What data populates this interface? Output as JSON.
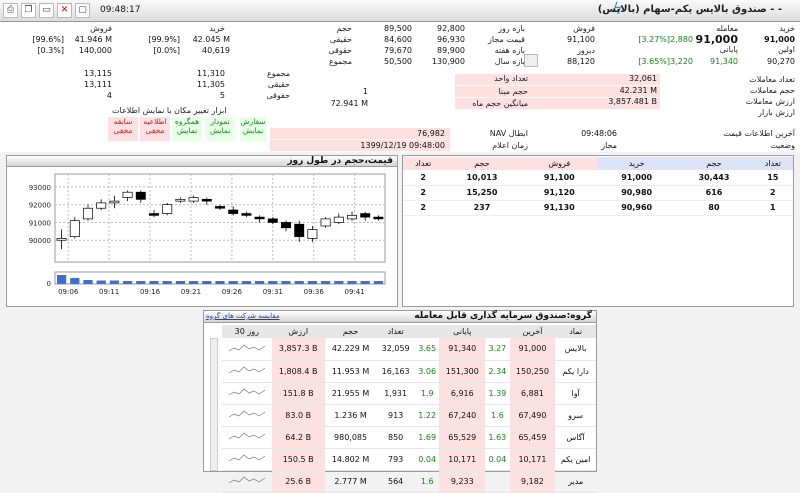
{
  "app": {
    "clock": "09:48:17",
    "title": "صندوق بالایس یکم-سهام (بالایس) - -"
  },
  "toolbar": {
    "icons": [
      "print",
      "copy",
      "save",
      "tools",
      "window",
      "close"
    ]
  },
  "info": {
    "col1": [
      {
        "label": "خرید",
        "value": "معامله"
      },
      {
        "label": "",
        "value": ""
      },
      {
        "label": "91,000",
        "value": "اولین"
      },
      {
        "label": "90,270",
        "value": "پایانی"
      }
    ],
    "trade": {
      "label": "معامله",
      "value": "91,000",
      "change": "2,880",
      "pct": "[3.27%]"
    },
    "first": {
      "label": "اولین",
      "value": "91,000"
    },
    "last": {
      "label": "پایانی",
      "value": "91,340",
      "change": "3,220",
      "pct": "[3.65%]",
      "buy": "90,270"
    },
    "yesterday": {
      "label": "دیروز",
      "value": "88,120"
    },
    "sale": {
      "label": "فروش",
      "value": ""
    },
    "range_day": {
      "label": "بازه روز",
      "low": "92,800",
      "high": "89,500"
    },
    "range_allowed": {
      "label": "قیمت مجاز",
      "low": "96,930",
      "high": "84,600"
    },
    "range_week": {
      "label": "بازه هفته",
      "low": "89,900",
      "high": "79,670"
    },
    "range_year": {
      "label": "بازه سال",
      "low": "130,900",
      "high": "50,500"
    },
    "allowed_val": "91,100",
    "count_headers": {
      "vol": "حجم",
      "buy": "خرید",
      "sell": "فروش"
    },
    "legal": {
      "label": "حقیقی",
      "vol": "42.045 M",
      "vol_pct": "[99.9%]",
      "sell_vol": "41.946 M",
      "sell_pct": "[99.6%]"
    },
    "legal2": {
      "label": "حقوقی",
      "vol": "40,619",
      "vol_pct": "[0.0%]",
      "sell_vol": "140,000",
      "sell_pct": "[0.3%]"
    },
    "counts_header": {
      "buy": "خرید",
      "sell": "فروش"
    },
    "total": {
      "label": "مجموع",
      "buy": "11,310",
      "sell": "13,115"
    },
    "real": {
      "label": "حقیقی",
      "buy": "11,305",
      "sell": "13,111"
    },
    "legalc": {
      "label": "حقوقی",
      "buy": "5",
      "sell": "4"
    },
    "unit": {
      "label": "تعداد واحد",
      "value": "32,061"
    },
    "basevol": {
      "label": "حجم مبنا",
      "value": "1"
    },
    "avgvol": {
      "label": "میانگین حجم ماه",
      "value": "72.941 M"
    },
    "trades": {
      "label": "تعداد معاملات",
      "value": "32,061"
    },
    "volume": {
      "label": "حجم معاملات",
      "value": "42.231 M"
    },
    "tvalue": {
      "label": "ارزش معاملات",
      "value": "3,857.481 B"
    },
    "mcap": {
      "label": "ارزش بازار",
      "value": ""
    },
    "nav_cancel": {
      "label": "NAV ابطال",
      "value": "76,982"
    },
    "nav_time": {
      "label": "زمان اعلام",
      "value": "1399/12/19 09:48:00"
    },
    "last_info": {
      "label": "آخرین اطلاعات قیمت",
      "value": "09:48:06"
    },
    "status": {
      "label": "وضعیت",
      "value": "مجاز"
    },
    "tools_note": "ابزار تغییر مکان یا نمایش اطلاعات",
    "buttons": [
      {
        "l1": "سفارش",
        "l2": "نمایش"
      },
      {
        "l1": "نمودار",
        "l2": "نمایش"
      },
      {
        "l1": "همگروه",
        "l2": "نمایش"
      },
      {
        "l1": "اطلاعیه",
        "l2": "مخفی"
      },
      {
        "l1": "سابقه",
        "l2": "مخفی"
      }
    ]
  },
  "orderbook": {
    "headers": [
      "تعداد",
      "حجم",
      "خرید",
      "فروش",
      "حجم",
      "تعداد"
    ],
    "rows": [
      [
        "15",
        "30,443",
        "91,000",
        "91,100",
        "10,013",
        "2"
      ],
      [
        "2",
        "616",
        "90,980",
        "91,120",
        "15,250",
        "2"
      ],
      [
        "1",
        "80",
        "90,960",
        "91,130",
        "237",
        "2"
      ]
    ]
  },
  "chart_panel": {
    "title": "قیمت،حجم در طول روز"
  },
  "chart_data": {
    "type": "candlestick",
    "title": "قیمت،حجم در طول روز",
    "x_ticks": [
      "09:06",
      "09:11",
      "09:16",
      "09:21",
      "09:26",
      "09:31",
      "09:36",
      "09:41"
    ],
    "y_ticks": [
      "93000",
      "92000",
      "91000",
      "90000"
    ],
    "y_vol_ticks": [
      "0"
    ],
    "ylim": [
      89000,
      93500
    ],
    "candles": [
      {
        "o": 90000,
        "c": 90100,
        "h": 90600,
        "l": 89500
      },
      {
        "o": 90200,
        "c": 91100,
        "h": 91300,
        "l": 90100
      },
      {
        "o": 91200,
        "c": 91800,
        "h": 92000,
        "l": 91100
      },
      {
        "o": 91800,
        "c": 92100,
        "h": 92300,
        "l": 91700
      },
      {
        "o": 92100,
        "c": 92200,
        "h": 92500,
        "l": 91800
      },
      {
        "o": 92400,
        "c": 92700,
        "h": 92800,
        "l": 92200
      },
      {
        "o": 92700,
        "c": 92300,
        "h": 92800,
        "l": 92100
      },
      {
        "o": 91500,
        "c": 91400,
        "h": 91700,
        "l": 91300
      },
      {
        "o": 91500,
        "c": 92000,
        "h": 92100,
        "l": 91400
      },
      {
        "o": 92200,
        "c": 92300,
        "h": 92400,
        "l": 92100
      },
      {
        "o": 92200,
        "c": 92400,
        "h": 92500,
        "l": 92100
      },
      {
        "o": 92300,
        "c": 92200,
        "h": 92400,
        "l": 92000
      },
      {
        "o": 91900,
        "c": 91800,
        "h": 92000,
        "l": 91700
      },
      {
        "o": 91700,
        "c": 91500,
        "h": 91900,
        "l": 91400
      },
      {
        "o": 91500,
        "c": 91400,
        "h": 91600,
        "l": 91300
      },
      {
        "o": 91300,
        "c": 91200,
        "h": 91400,
        "l": 91000
      },
      {
        "o": 91200,
        "c": 91000,
        "h": 91300,
        "l": 90900
      },
      {
        "o": 91000,
        "c": 90700,
        "h": 91100,
        "l": 90500
      },
      {
        "o": 90900,
        "c": 90200,
        "h": 91100,
        "l": 89900
      },
      {
        "o": 90100,
        "c": 90600,
        "h": 90800,
        "l": 89900
      },
      {
        "o": 90800,
        "c": 91200,
        "h": 91300,
        "l": 90700
      },
      {
        "o": 91000,
        "c": 91300,
        "h": 91500,
        "l": 90900
      },
      {
        "o": 91200,
        "c": 91400,
        "h": 91600,
        "l": 91100
      },
      {
        "o": 91500,
        "c": 91300,
        "h": 91600,
        "l": 91100
      },
      {
        "o": 91300,
        "c": 91200,
        "h": 91400,
        "l": 91100
      }
    ],
    "volumes": [
      0.9,
      0.6,
      0.4,
      0.35,
      0.35,
      0.3,
      0.3,
      0.3,
      0.3,
      0.3,
      0.3,
      0.3,
      0.3,
      0.3,
      0.3,
      0.3,
      0.3,
      0.3,
      0.3,
      0.3,
      0.3,
      0.3,
      0.3,
      0.3,
      0.3
    ],
    "bull_color": "#ffffff",
    "bear_color": "#000000",
    "vol_color": "#3a6fd8"
  },
  "group": {
    "title": "گروه:صندوق سرمایه گذاری قابل معامله",
    "link": "مقایسه شرکت های گروه",
    "headers": [
      "نماد",
      "آخرین",
      "",
      "پایانی",
      "",
      "تعداد",
      "حجم",
      "ارزش",
      "30 روز"
    ],
    "rows": [
      [
        "بالایس",
        "91,000",
        "3.27",
        "91,340",
        "3.65",
        "32,059",
        "42.229 M",
        "3,857.3 B"
      ],
      [
        "دارا یکم",
        "150,250",
        "2.34",
        "151,300",
        "3.06",
        "16,163",
        "11.953 M",
        "1,808.4 B"
      ],
      [
        "آوا",
        "6,881",
        "1.39",
        "6,916",
        "1.9",
        "1,931",
        "21.955 M",
        "151.8 B"
      ],
      [
        "سرو",
        "67,490",
        "1.6",
        "67,240",
        "1.22",
        "913",
        "1.236 M",
        "83.0 B"
      ],
      [
        "آگاس",
        "65,459",
        "1.63",
        "65,529",
        "1.69",
        "850",
        "980,085",
        "64.2 B"
      ],
      [
        "امین یکم",
        "10,171",
        "0.04",
        "10,171",
        "0.04",
        "793",
        "14.802 M",
        "150.5 B"
      ],
      [
        "مدیر",
        "9,182",
        "",
        "9,233",
        "1.6",
        "564",
        "2.777 M",
        "25.6 B"
      ]
    ]
  }
}
